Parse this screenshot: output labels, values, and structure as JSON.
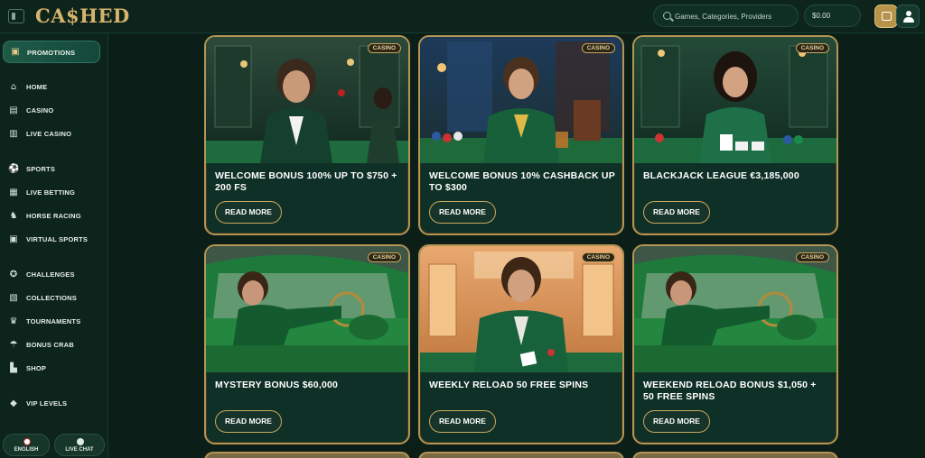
{
  "header": {
    "logo_text": "CA$HED",
    "search_placeholder": "Games, Categories, Providers",
    "balance": "$0.00"
  },
  "sidebar": {
    "promotions": "PROMOTIONS",
    "items": [
      {
        "label": "HOME",
        "icon": "home-icon"
      },
      {
        "label": "CASINO",
        "icon": "casino-icon"
      },
      {
        "label": "LIVE CASINO",
        "icon": "live-casino-icon"
      },
      {
        "label": "SPORTS",
        "icon": "sports-icon"
      },
      {
        "label": "LIVE BETTING",
        "icon": "live-betting-icon"
      },
      {
        "label": "HORSE RACING",
        "icon": "horse-icon"
      },
      {
        "label": "VIRTUAL SPORTS",
        "icon": "virtual-sports-icon"
      },
      {
        "label": "CHALLENGES",
        "icon": "challenges-icon"
      },
      {
        "label": "COLLECTIONS",
        "icon": "collections-icon"
      },
      {
        "label": "TOURNAMENTS",
        "icon": "trophy-icon"
      },
      {
        "label": "BONUS CRAB",
        "icon": "crab-icon"
      },
      {
        "label": "SHOP",
        "icon": "shop-icon"
      },
      {
        "label": "VIP LEVELS",
        "icon": "diamond-icon"
      }
    ],
    "language_label": "ENGLISH",
    "chat_label": "LIVE CHAT"
  },
  "promotions": [
    {
      "title": "WELCOME BONUS 100% UP TO $750 + 200 FS",
      "badge": "CASINO",
      "button": "READ MORE",
      "art": "man-dealer-roulette"
    },
    {
      "title": "WELCOME BONUS 10% CASHBACK UP TO $300",
      "badge": "CASINO",
      "button": "READ MORE",
      "art": "man-poker-chips"
    },
    {
      "title": "BLACKJACK LEAGUE €3,185,000",
      "badge": "CASINO",
      "button": "READ MORE",
      "art": "woman-blackjack"
    },
    {
      "title": "MYSTERY BONUS $60,000",
      "badge": "CASINO",
      "button": "READ MORE",
      "art": "man-green-car"
    },
    {
      "title": "WEEKLY RELOAD 50 FREE SPINS",
      "badge": "CASINO",
      "button": "READ MORE",
      "art": "man-cards-hall"
    },
    {
      "title": "WEEKEND RELOAD BONUS $1,050 + 50 FREE SPINS",
      "badge": "CASINO",
      "button": "READ MORE",
      "art": "man-green-car"
    }
  ],
  "colors": {
    "background": "#0b1f18",
    "gold": "#b49553",
    "card": "#0f3026"
  }
}
